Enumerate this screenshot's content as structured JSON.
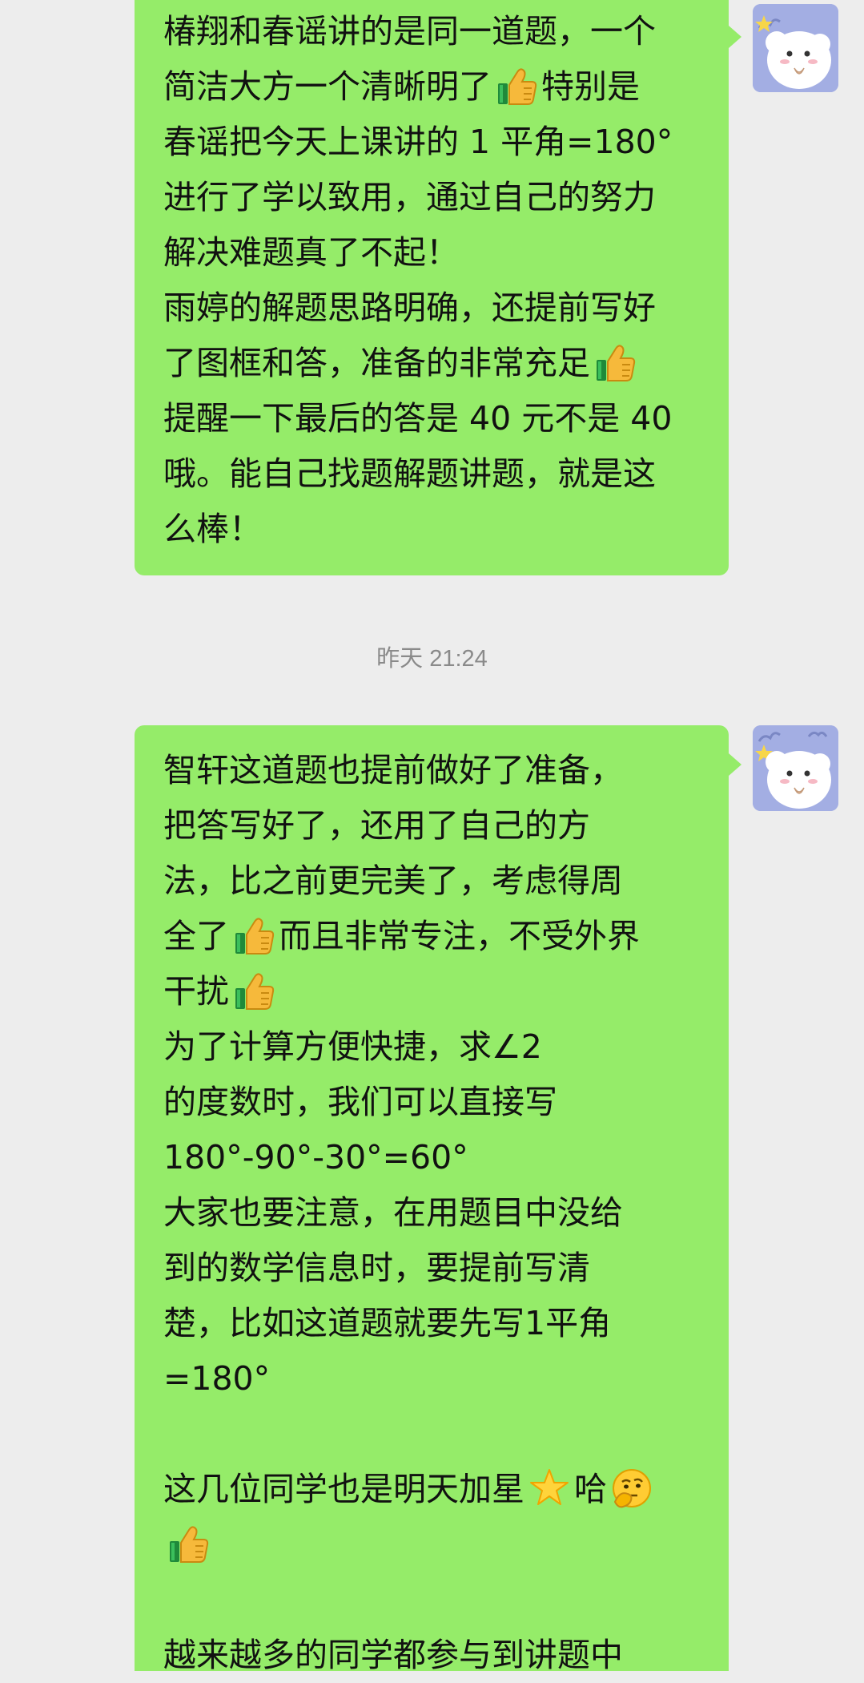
{
  "messages": [
    {
      "lines": [
        "椿翔和春谣讲的是同一道题，一个",
        [
          "简洁大方一个清晰明了",
          "thumbs-up",
          "特别是"
        ],
        "春谣把今天上课讲的 1 平角=180°",
        "进行了学以致用，通过自己的努力",
        "解决难题真了不起！",
        "雨婷的解题思路明确，还提前写好",
        [
          "了图框和答，准备的非常充足",
          "thumbs-up",
          ""
        ],
        "提醒一下最后的答是 40 元不是 40",
        "哦。能自己找题解题讲题，就是这",
        "么棒！"
      ]
    },
    {
      "lines": [
        "智轩这道题也提前做好了准备，",
        "把答写好了，还用了自己的方",
        "法，比之前更完美了，考虑得周",
        [
          "全了",
          "thumbs-up",
          "而且非常专注，不受外界"
        ],
        [
          "干扰",
          "thumbs-up",
          ""
        ],
        "为了计算方便快捷，求∠2",
        "的度数时，我们可以直接写",
        "180°-90°-30°=60°",
        "大家也要注意，在用题目中没给",
        "到的数学信息时，要提前写清",
        "楚，比如这道题就要先写1平角",
        "=180°",
        "",
        [
          "这几位同学也是明天加星",
          "star",
          "哈",
          "thinking"
        ],
        [
          "",
          "thumbs-up",
          ""
        ],
        "",
        "越来越多的同学都参与到讲题中"
      ]
    }
  ],
  "timestamp": "昨天 21:24",
  "icons": {
    "avatar": "avatar-cartoon-sheep",
    "thumbs_up": "thumbs-up-icon",
    "star": "star-icon",
    "thinking": "thinking-face-icon"
  },
  "colors": {
    "background": "#ededed",
    "bubble": "#95ec69",
    "timestamp": "#8a8a8a"
  }
}
